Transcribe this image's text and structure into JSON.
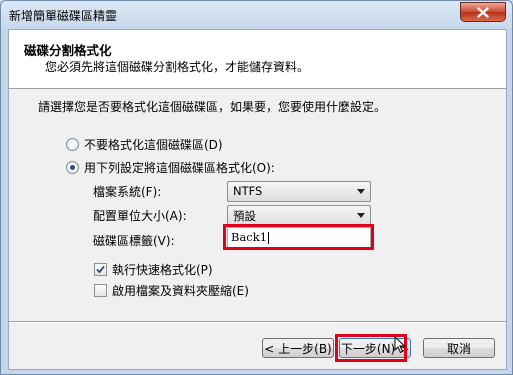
{
  "window": {
    "title": "新增簡單磁碟區精靈"
  },
  "header": {
    "title": "磁碟分割格式化",
    "subtitle": "您必須先將這個磁碟分割格式化，才能儲存資料。"
  },
  "prompt": "請選擇您是否要格式化這個磁碟區，如果要，您要使用什麼設定。",
  "options": {
    "no_format": {
      "label": "不要格式化這個磁碟區(D)",
      "selected": false
    },
    "format": {
      "label": "用下列設定將這個磁碟區格式化(O):",
      "selected": true
    }
  },
  "fields": {
    "filesystem": {
      "label": "檔案系統(F):",
      "value": "NTFS"
    },
    "allocation": {
      "label": "配置單位大小(A):",
      "value": "預設"
    },
    "volume_label": {
      "label": "磁碟區標籤(V):",
      "value": "Back1"
    }
  },
  "checkboxes": {
    "quick_format": {
      "label": "執行快速格式化(P)",
      "checked": true
    },
    "compression": {
      "label": "啟用檔案及資料夾壓縮(E)",
      "checked": false
    }
  },
  "buttons": {
    "back": "< 上一步(B)",
    "next": "下一步(N) >",
    "cancel": "取消"
  },
  "colors": {
    "highlight": "#e0001b",
    "window_frame": "#c5d6ea",
    "client_bg": "#f0f0f0"
  }
}
